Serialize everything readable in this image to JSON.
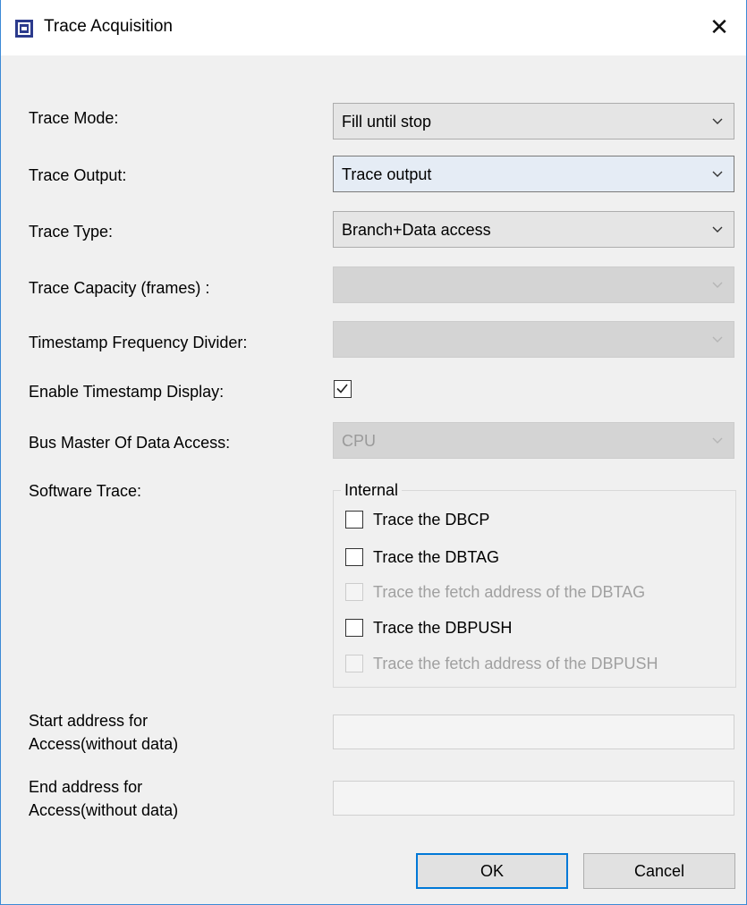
{
  "window": {
    "title": "Trace Acquisition",
    "close_glyph": "✕",
    "icon": "app-chip-icon"
  },
  "form": {
    "trace_mode": {
      "label": "Trace Mode:",
      "value": "Fill until stop"
    },
    "trace_output": {
      "label": "Trace Output:",
      "value": "Trace output"
    },
    "trace_type": {
      "label": "Trace Type:",
      "value": "Branch+Data access"
    },
    "trace_capacity": {
      "label": "Trace Capacity (frames) :",
      "value": ""
    },
    "timestamp_divider": {
      "label": "Timestamp Frequency Divider:",
      "value": ""
    },
    "enable_timestamp": {
      "label": "Enable Timestamp Display:",
      "checked": true
    },
    "bus_master": {
      "label": "Bus Master Of Data Access:",
      "value": "CPU"
    },
    "software_trace": {
      "label": "Software Trace:"
    },
    "start_address": {
      "label_line1": "Start address for",
      "label_line2": "Access(without data)",
      "value": ""
    },
    "end_address": {
      "label_line1": "End address for",
      "label_line2": "Access(without data)",
      "value": ""
    }
  },
  "internal_group": {
    "legend": "Internal",
    "items": [
      {
        "label": "Trace the DBCP",
        "checked": false,
        "enabled": true
      },
      {
        "label": "Trace the DBTAG",
        "checked": false,
        "enabled": true
      },
      {
        "label": "Trace the fetch address of the DBTAG",
        "checked": false,
        "enabled": false
      },
      {
        "label": "Trace the DBPUSH",
        "checked": false,
        "enabled": true
      },
      {
        "label": "Trace the fetch address of the DBPUSH",
        "checked": false,
        "enabled": false
      }
    ]
  },
  "buttons": {
    "ok": "OK",
    "cancel": "Cancel"
  },
  "colors": {
    "accent": "#0078d7",
    "window_border": "#3c8ad6",
    "background": "#f0f0f0"
  }
}
